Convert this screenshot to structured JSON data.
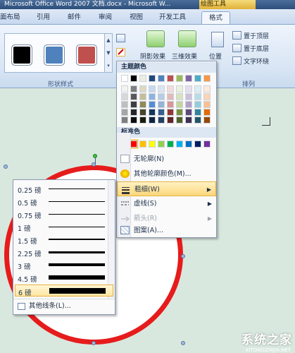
{
  "window": {
    "title": "Microsoft Office Word 2007 文档.docx - Microsoft W...",
    "context_tab": "绘图工具"
  },
  "tabs": [
    "面布局",
    "引用",
    "邮件",
    "审阅",
    "视图",
    "开发工具",
    "格式"
  ],
  "ribbon": {
    "shape_styles_label": "形状样式",
    "arrange_label": "排列",
    "shadow_effect": "阴影效果",
    "threed_effect": "三维效果",
    "position": "位置",
    "bring_to_front": "置于顶层",
    "send_to_back": "置于底层",
    "text_wrap": "文字环绕",
    "styles": [
      {
        "color": "#000000"
      },
      {
        "color": "#4f81bd"
      },
      {
        "color": "#c0504d"
      }
    ]
  },
  "color_menu": {
    "theme_colors_label": "主题颜色",
    "standard_colors_label": "标准色",
    "no_outline": "无轮廓(N)",
    "more_colors": "其他轮廓颜色(M)...",
    "weight": "粗细(W)",
    "dashes": "虚线(S)",
    "arrows": "箭头(R)",
    "pattern": "图案(A)...",
    "theme_top": [
      "#ffffff",
      "#000000",
      "#eeece1",
      "#1f497d",
      "#4f81bd",
      "#c0504d",
      "#9bbb59",
      "#8064a2",
      "#4bacc6",
      "#f79646"
    ],
    "theme_shades": [
      [
        "#f2f2f2",
        "#7f7f7f",
        "#ddd9c3",
        "#c6d9f0",
        "#dbe5f1",
        "#f2dcdb",
        "#ebf1dd",
        "#e5e0ec",
        "#dbeef3",
        "#fdeada"
      ],
      [
        "#d8d8d8",
        "#595959",
        "#c4bd97",
        "#8db3e2",
        "#b8cce4",
        "#e5b9b7",
        "#d7e3bc",
        "#ccc1d9",
        "#b7dde8",
        "#fbd5b5"
      ],
      [
        "#bfbfbf",
        "#3f3f3f",
        "#938953",
        "#548dd4",
        "#95b3d7",
        "#d99694",
        "#c3d69b",
        "#b2a2c7",
        "#92cddc",
        "#fac08f"
      ],
      [
        "#a5a5a5",
        "#262626",
        "#494429",
        "#17365d",
        "#366092",
        "#953734",
        "#76923c",
        "#5f497a",
        "#31859b",
        "#e36c09"
      ],
      [
        "#7f7f7f",
        "#0c0c0c",
        "#1d1b10",
        "#0f243e",
        "#244061",
        "#632423",
        "#4f6128",
        "#3f3151",
        "#205867",
        "#974806"
      ]
    ],
    "standard": [
      "#c00000",
      "#ff0000",
      "#ffc000",
      "#ffff00",
      "#92d050",
      "#00b050",
      "#00b0f0",
      "#0070c0",
      "#002060",
      "#7030a0"
    ],
    "selected_standard_index": 1
  },
  "weight_menu": {
    "items": [
      {
        "label": "0.25 磅",
        "weight": 0.25
      },
      {
        "label": "0.5 磅",
        "weight": 0.5
      },
      {
        "label": "0.75 磅",
        "weight": 0.75
      },
      {
        "label": "1 磅",
        "weight": 1
      },
      {
        "label": "1.5 磅",
        "weight": 1.5
      },
      {
        "label": "2.25 磅",
        "weight": 2.25
      },
      {
        "label": "3 磅",
        "weight": 3
      },
      {
        "label": "4.5 磅",
        "weight": 4.5
      },
      {
        "label": "6 磅",
        "weight": 6
      }
    ],
    "selected_index": 8,
    "more_lines": "其他线条(L)..."
  },
  "watermark": {
    "text": "系统之家",
    "sub": "XITONGZHIJIA.NET"
  }
}
